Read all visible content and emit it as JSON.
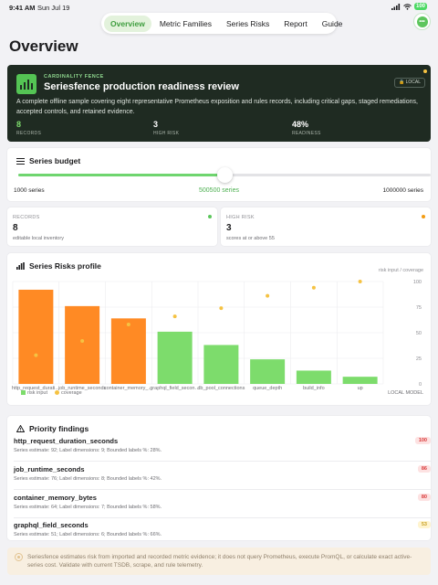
{
  "status": {
    "time": "9:41 AM",
    "date": "Sun Jul 19",
    "battery": "100"
  },
  "nav": {
    "tabs": [
      "Overview",
      "Metric Families",
      "Series Risks",
      "Report",
      "Guide"
    ],
    "active": "Overview"
  },
  "page": {
    "title": "Overview"
  },
  "hero": {
    "eyebrow": "CARDINALITY FENCE",
    "title": "Seriesfence production readiness review",
    "badge": "LOCAL",
    "description": "A complete offline sample covering eight representative Prometheus exposition and rules records, including critical gaps, staged remediations, accepted controls, and retained evidence.",
    "stats": [
      {
        "value": "8",
        "label": "RECORDS"
      },
      {
        "value": "3",
        "label": "HIGH RISK"
      },
      {
        "value": "48%",
        "label": "READINESS"
      }
    ]
  },
  "budget": {
    "title": "Series budget",
    "min_label": "1000 series",
    "current_label": "500500 series",
    "max_label": "1000000 series",
    "min": 1000,
    "max": 1000000,
    "value": 500500
  },
  "stats": [
    {
      "eyebrow": "RECORDS",
      "value": "8",
      "sub": "editable local inventory",
      "dot": "#5cc65c"
    },
    {
      "eyebrow": "HIGH RISK",
      "value": "3",
      "sub": "scores at or above 55",
      "dot": "#f39c12"
    }
  ],
  "profile": {
    "title": "Series Risks profile",
    "caption": "risk input / coverage",
    "legend": [
      "risk input",
      "coverage"
    ],
    "model_label": "LOCAL MODEL"
  },
  "chart_data": {
    "type": "bar",
    "categories": [
      "http_request_durati…",
      "job_runtime_seconds",
      "container_memory_…",
      "graphql_field_secon…",
      "db_pool_connections",
      "queue_depth",
      "build_info",
      "up"
    ],
    "series": [
      {
        "name": "risk input",
        "values": [
          92,
          76,
          64,
          51,
          38,
          24,
          13,
          7
        ],
        "colors": [
          "#ff8a24",
          "#ff8a24",
          "#ff8a24",
          "#7ddc6c",
          "#7ddc6c",
          "#7ddc6c",
          "#7ddc6c",
          "#7ddc6c"
        ]
      },
      {
        "name": "coverage",
        "values": [
          28,
          42,
          58,
          66,
          74,
          86,
          94,
          100
        ],
        "color": "#f5c242"
      }
    ],
    "yticks": [
      0,
      25,
      50,
      75,
      100
    ],
    "ylim": [
      0,
      100
    ],
    "grid": true,
    "legend_position": "bottom-left"
  },
  "findings": {
    "title": "Priority findings",
    "items": [
      {
        "name": "http_request_duration_seconds",
        "desc": "Series estimate: 92; Label dimensions: 9; Bounded labels %: 28%.",
        "score": "100",
        "bg": "#fde2e2",
        "fg": "#d93b3b"
      },
      {
        "name": "job_runtime_seconds",
        "desc": "Series estimate: 76; Label dimensions: 8; Bounded labels %: 42%.",
        "score": "86",
        "bg": "#fde2e2",
        "fg": "#d93b3b"
      },
      {
        "name": "container_memory_bytes",
        "desc": "Series estimate: 64; Label dimensions: 7; Bounded labels %: 58%.",
        "score": "80",
        "bg": "#fde2e2",
        "fg": "#d93b3b"
      },
      {
        "name": "graphql_field_seconds",
        "desc": "Series estimate: 51; Label dimensions: 6; Bounded labels %: 66%.",
        "score": "53",
        "bg": "#fff4cf",
        "fg": "#c9a227"
      }
    ]
  },
  "footer": {
    "note": "Seriesfence estimates risk from imported and recorded metric evidence; it does not query Prometheus, execute PromQL, or calculate exact active-series cost. Validate with current TSDB, scrape, and rule telemetry."
  }
}
